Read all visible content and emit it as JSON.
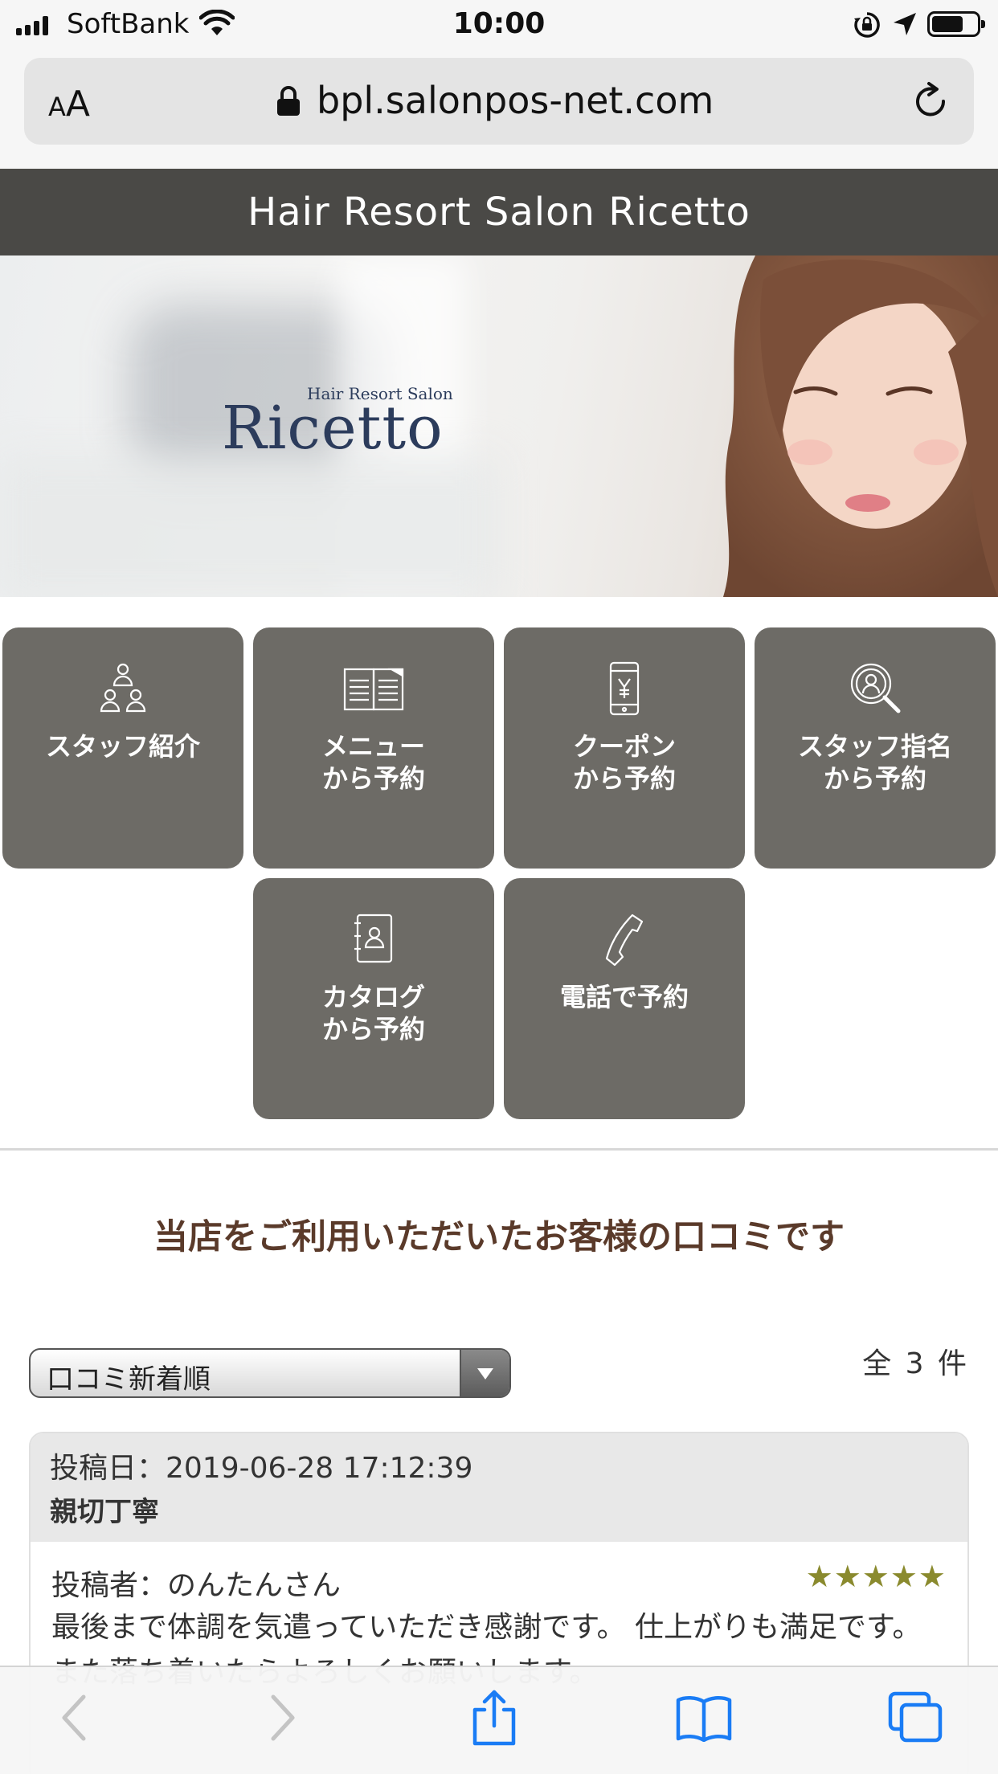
{
  "status_bar": {
    "carrier": "SoftBank",
    "time": "10:00",
    "battery_level": 0.7,
    "icons": [
      "signal-icon",
      "wifi-icon",
      "rotation-lock-icon",
      "location-arrow-icon",
      "battery-icon"
    ]
  },
  "browser": {
    "text_size_label": "AA",
    "url": "bpl.salonpos-net.com",
    "icons": [
      "lock-icon",
      "reload-icon"
    ]
  },
  "header": {
    "title": "Hair Resort Salon Ricetto"
  },
  "hero": {
    "logo_tagline": "Hair Resort Salon",
    "logo_name": "Ricetto"
  },
  "menu": {
    "tiles": [
      {
        "label": "スタッフ紹介",
        "icon": "staff-group-icon"
      },
      {
        "label": "メニュー\nから予約",
        "icon": "menu-book-icon"
      },
      {
        "label": "クーポン\nから予約",
        "icon": "coupon-phone-icon"
      },
      {
        "label": "スタッフ指名\nから予約",
        "icon": "staff-search-icon"
      },
      {
        "label": "カタログ\nから予約",
        "icon": "catalog-icon"
      },
      {
        "label": "電話で予約",
        "icon": "telephone-icon"
      }
    ]
  },
  "reviews": {
    "heading": "当店をご利用いただいたお客様の口コミです",
    "sort_selected": "口コミ新着順",
    "total": "全 3 件",
    "items": [
      {
        "date": "投稿日：2019-06-28 17:12:39",
        "title": "親切丁寧",
        "author": "投稿者：のんたんさん",
        "stars": "★★★★★",
        "rating": 5,
        "body": "最後まで体調を気遣っていただき感謝です。 仕上がりも満足です。 また落ち着いたらよろしくお願いします。"
      }
    ]
  },
  "toolbar": {
    "icons": [
      "back-icon",
      "forward-icon",
      "share-icon",
      "bookmarks-icon",
      "tabs-icon"
    ],
    "accent": "#1a7cf5"
  }
}
